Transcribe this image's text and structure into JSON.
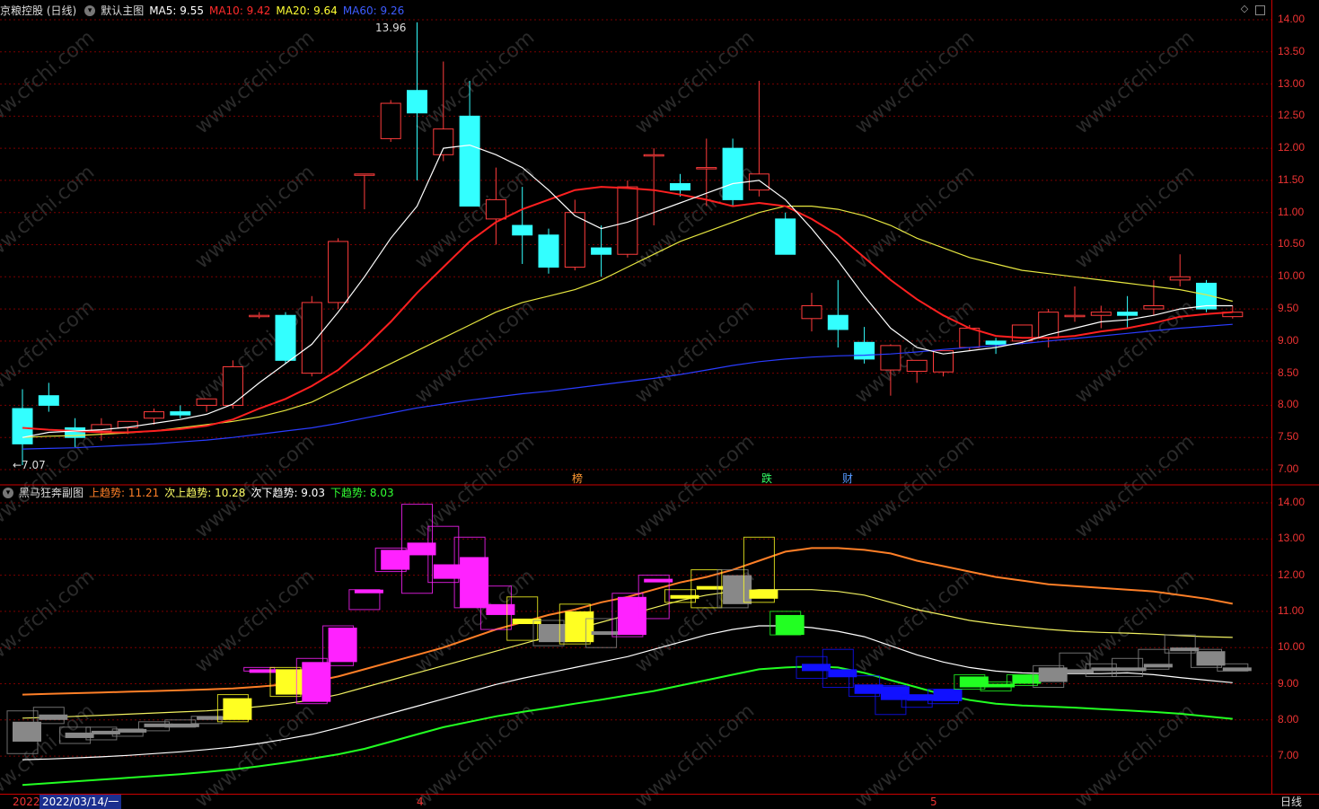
{
  "main": {
    "stock_label": "京粮控股 (日线)",
    "chart_label": "默认主图",
    "ma": [
      {
        "label": "MA5: 9.55",
        "color": "#ffffff"
      },
      {
        "label": "MA10: 9.42",
        "color": "#ff2b2b"
      },
      {
        "label": "MA20: 9.64",
        "color": "#ffff33"
      },
      {
        "label": "MA60: 9.26",
        "color": "#3d5cff"
      }
    ],
    "high_label": "13.96",
    "low_label": "←7.07",
    "ticks": [
      "14.00",
      "13.50",
      "13.00",
      "12.50",
      "12.00",
      "11.50",
      "11.00",
      "10.50",
      "10.00",
      "9.50",
      "9.00",
      "8.50",
      "8.00",
      "7.50",
      "7.00"
    ],
    "events": [
      {
        "label": "榜",
        "color": "#ff9933"
      },
      {
        "label": "跌",
        "color": "#33ff66"
      },
      {
        "label": "财",
        "color": "#5599ff"
      }
    ]
  },
  "sub": {
    "chart_label": "黑马狂奔副图",
    "lines": [
      {
        "label": "上趋势: 11.21",
        "color": "#ff7f27"
      },
      {
        "label": "次上趋势: 10.28",
        "color": "#ffff66"
      },
      {
        "label": "次下趋势: 9.03",
        "color": "#ffffff"
      },
      {
        "label": "下趋势: 8.03",
        "color": "#33ff33"
      }
    ],
    "ticks": [
      "14.00",
      "13.00",
      "12.00",
      "11.00",
      "10.00",
      "9.00",
      "8.00",
      "7.00"
    ]
  },
  "bottom": {
    "year": "2022",
    "date": "2022/03/14/一",
    "month_marks": [
      "4",
      "5"
    ],
    "period": "日线"
  },
  "watermark": "www.cfchi.com",
  "chart_data": {
    "type": "candlestick",
    "candles": [
      [
        7.95,
        8.25,
        7.07,
        7.4
      ],
      [
        8.15,
        8.35,
        7.9,
        8.0
      ],
      [
        7.65,
        7.8,
        7.35,
        7.5
      ],
      [
        7.6,
        7.8,
        7.45,
        7.7
      ],
      [
        7.65,
        7.75,
        7.55,
        7.75
      ],
      [
        7.8,
        7.95,
        7.7,
        7.9
      ],
      [
        7.9,
        8.0,
        7.8,
        7.85
      ],
      [
        8.0,
        8.1,
        7.9,
        8.1
      ],
      [
        8.0,
        8.7,
        7.95,
        8.6
      ],
      [
        9.4,
        9.45,
        9.35,
        9.4
      ],
      [
        9.4,
        9.45,
        8.65,
        8.7
      ],
      [
        8.5,
        9.7,
        8.45,
        9.6
      ],
      [
        9.6,
        10.6,
        9.5,
        10.55
      ],
      [
        11.6,
        11.6,
        11.05,
        11.6
      ],
      [
        12.15,
        12.75,
        12.1,
        12.7
      ],
      [
        12.9,
        13.96,
        11.5,
        12.55
      ],
      [
        11.9,
        13.35,
        11.8,
        12.3
      ],
      [
        12.5,
        13.05,
        11.1,
        11.1
      ],
      [
        10.9,
        11.7,
        10.5,
        11.2
      ],
      [
        10.8,
        11.4,
        10.2,
        10.65
      ],
      [
        10.65,
        10.75,
        10.05,
        10.15
      ],
      [
        10.15,
        11.2,
        10.1,
        11.0
      ],
      [
        10.45,
        10.8,
        10.0,
        10.35
      ],
      [
        10.35,
        11.5,
        10.3,
        11.4
      ],
      [
        11.9,
        12.0,
        10.8,
        11.9
      ],
      [
        11.45,
        11.6,
        11.25,
        11.35
      ],
      [
        11.7,
        12.15,
        11.1,
        11.7
      ],
      [
        12.0,
        12.15,
        11.1,
        11.2
      ],
      [
        11.35,
        13.05,
        11.25,
        11.6
      ],
      [
        10.9,
        11.0,
        10.35,
        10.35
      ],
      [
        9.35,
        9.75,
        9.15,
        9.55
      ],
      [
        9.4,
        9.95,
        8.9,
        9.18
      ],
      [
        8.98,
        9.22,
        8.65,
        8.72
      ],
      [
        8.55,
        8.95,
        8.15,
        8.93
      ],
      [
        8.53,
        8.7,
        8.35,
        8.7
      ],
      [
        8.52,
        8.85,
        8.45,
        8.85
      ],
      [
        8.9,
        9.25,
        8.85,
        9.2
      ],
      [
        9.0,
        9.05,
        8.8,
        8.95
      ],
      [
        9.0,
        9.25,
        8.95,
        9.25
      ],
      [
        9.05,
        9.5,
        8.9,
        9.45
      ],
      [
        9.4,
        9.85,
        9.3,
        9.4
      ],
      [
        9.4,
        9.55,
        9.2,
        9.45
      ],
      [
        9.45,
        9.7,
        9.2,
        9.4
      ],
      [
        9.5,
        9.95,
        9.4,
        9.55
      ],
      [
        9.95,
        10.35,
        9.85,
        10.0
      ],
      [
        9.9,
        9.95,
        9.45,
        9.5
      ],
      [
        9.38,
        9.55,
        9.35,
        9.45
      ]
    ],
    "ma5": [
      7.5,
      7.58,
      7.6,
      7.62,
      7.66,
      7.72,
      7.78,
      7.86,
      8.02,
      8.35,
      8.65,
      8.95,
      9.45,
      10.0,
      10.6,
      11.1,
      12.0,
      12.05,
      11.9,
      11.7,
      11.35,
      10.95,
      10.75,
      10.85,
      11.0,
      11.15,
      11.3,
      11.45,
      11.5,
      11.2,
      10.75,
      10.25,
      9.7,
      9.2,
      8.9,
      8.8,
      8.85,
      8.9,
      8.98,
      9.1,
      9.2,
      9.3,
      9.33,
      9.4,
      9.5,
      9.55,
      9.55
    ],
    "ma10": [
      7.65,
      7.62,
      7.6,
      7.58,
      7.58,
      7.6,
      7.63,
      7.68,
      7.78,
      7.95,
      8.1,
      8.3,
      8.55,
      8.9,
      9.3,
      9.75,
      10.15,
      10.55,
      10.85,
      11.05,
      11.2,
      11.35,
      11.4,
      11.38,
      11.35,
      11.28,
      11.2,
      11.1,
      11.15,
      11.1,
      10.9,
      10.65,
      10.3,
      9.95,
      9.65,
      9.4,
      9.2,
      9.08,
      9.05,
      9.05,
      9.08,
      9.15,
      9.2,
      9.28,
      9.38,
      9.42,
      9.45
    ],
    "ma20": [
      7.5,
      7.52,
      7.53,
      7.55,
      7.57,
      7.6,
      7.65,
      7.7,
      7.75,
      7.82,
      7.92,
      8.05,
      8.25,
      8.45,
      8.65,
      8.85,
      9.05,
      9.25,
      9.45,
      9.6,
      9.7,
      9.8,
      9.95,
      10.15,
      10.35,
      10.55,
      10.7,
      10.85,
      11.0,
      11.1,
      11.1,
      11.05,
      10.95,
      10.8,
      10.6,
      10.45,
      10.3,
      10.2,
      10.1,
      10.05,
      10.0,
      9.95,
      9.9,
      9.85,
      9.8,
      9.72,
      9.62
    ],
    "ma60": [
      7.32,
      7.33,
      7.34,
      7.36,
      7.38,
      7.4,
      7.43,
      7.46,
      7.5,
      7.55,
      7.6,
      7.65,
      7.72,
      7.8,
      7.88,
      7.96,
      8.02,
      8.08,
      8.13,
      8.18,
      8.22,
      8.27,
      8.32,
      8.37,
      8.42,
      8.48,
      8.55,
      8.62,
      8.68,
      8.72,
      8.75,
      8.77,
      8.78,
      8.8,
      8.83,
      8.87,
      8.9,
      8.93,
      8.96,
      9.0,
      9.04,
      9.08,
      9.12,
      9.16,
      9.2,
      9.23,
      9.26
    ],
    "trend_up": [
      8.7,
      8.72,
      8.74,
      8.76,
      8.78,
      8.8,
      8.82,
      8.84,
      8.87,
      8.92,
      8.98,
      9.05,
      9.2,
      9.4,
      9.6,
      9.8,
      10.0,
      10.25,
      10.5,
      10.7,
      10.9,
      11.05,
      11.25,
      11.4,
      11.6,
      11.8,
      11.95,
      12.15,
      12.4,
      12.65,
      12.75,
      12.75,
      12.7,
      12.6,
      12.4,
      12.25,
      12.1,
      11.95,
      11.85,
      11.75,
      11.7,
      11.65,
      11.6,
      11.55,
      11.45,
      11.35,
      11.21
    ],
    "trend_up2": [
      8.05,
      8.07,
      8.1,
      8.13,
      8.16,
      8.19,
      8.22,
      8.25,
      8.3,
      8.37,
      8.45,
      8.55,
      8.7,
      8.9,
      9.1,
      9.3,
      9.5,
      9.7,
      9.9,
      10.1,
      10.3,
      10.5,
      10.7,
      10.9,
      11.1,
      11.3,
      11.45,
      11.55,
      11.6,
      11.6,
      11.6,
      11.55,
      11.45,
      11.25,
      11.05,
      10.9,
      10.75,
      10.65,
      10.57,
      10.5,
      10.45,
      10.42,
      10.4,
      10.37,
      10.33,
      10.3,
      10.28
    ],
    "trend_down2": [
      6.9,
      6.92,
      6.95,
      6.98,
      7.02,
      7.07,
      7.12,
      7.18,
      7.25,
      7.35,
      7.47,
      7.6,
      7.78,
      7.98,
      8.18,
      8.38,
      8.58,
      8.78,
      8.98,
      9.15,
      9.3,
      9.45,
      9.6,
      9.75,
      9.95,
      10.15,
      10.35,
      10.5,
      10.6,
      10.6,
      10.55,
      10.45,
      10.3,
      10.05,
      9.8,
      9.6,
      9.45,
      9.35,
      9.3,
      9.28,
      9.28,
      9.28,
      9.3,
      9.25,
      9.17,
      9.1,
      9.03
    ],
    "trend_down": [
      6.2,
      6.25,
      6.3,
      6.35,
      6.4,
      6.45,
      6.5,
      6.56,
      6.63,
      6.72,
      6.82,
      6.93,
      7.05,
      7.2,
      7.4,
      7.6,
      7.8,
      7.95,
      8.1,
      8.22,
      8.33,
      8.45,
      8.56,
      8.68,
      8.8,
      8.95,
      9.1,
      9.25,
      9.4,
      9.45,
      9.48,
      9.45,
      9.3,
      9.1,
      8.9,
      8.7,
      8.55,
      8.45,
      8.4,
      8.37,
      8.34,
      8.3,
      8.26,
      8.22,
      8.17,
      8.1,
      8.03
    ]
  }
}
